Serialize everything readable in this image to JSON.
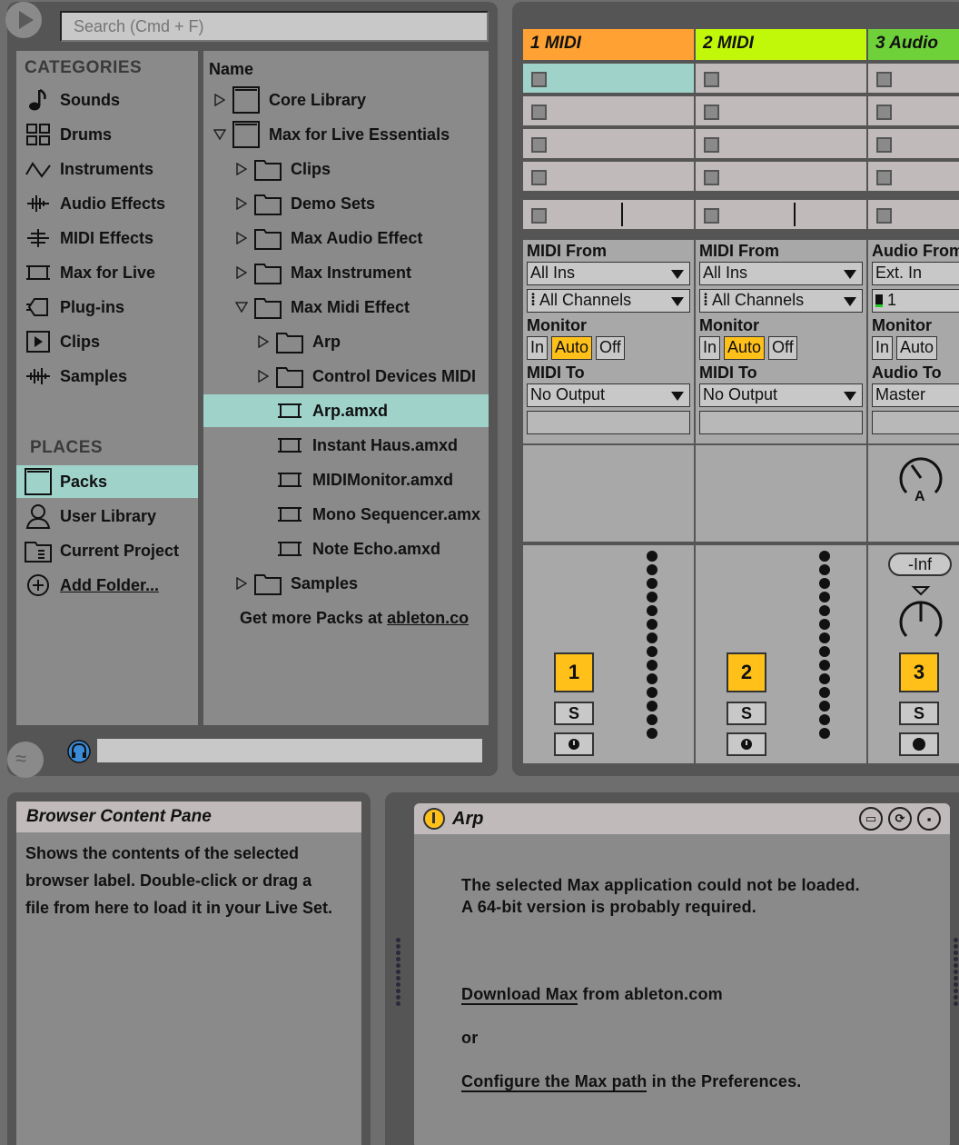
{
  "browser": {
    "search_placeholder": "Search (Cmd + F)",
    "categories_heading": "CATEGORIES",
    "categories": [
      {
        "label": "Sounds",
        "icon": "note-icon"
      },
      {
        "label": "Drums",
        "icon": "grid-icon"
      },
      {
        "label": "Instruments",
        "icon": "waveform-icon"
      },
      {
        "label": "Audio Effects",
        "icon": "audio-effect-icon"
      },
      {
        "label": "MIDI Effects",
        "icon": "midi-effect-icon"
      },
      {
        "label": "Max for Live",
        "icon": "max-device-icon"
      },
      {
        "label": "Plug-ins",
        "icon": "plugin-icon"
      },
      {
        "label": "Clips",
        "icon": "clip-icon"
      },
      {
        "label": "Samples",
        "icon": "sample-wave-icon"
      }
    ],
    "places_heading": "PLACES",
    "places": [
      {
        "label": "Packs",
        "icon": "pack-icon",
        "selected": true
      },
      {
        "label": "User Library",
        "icon": "user-icon"
      },
      {
        "label": "Current Project",
        "icon": "project-icon"
      },
      {
        "label": "Add Folder...",
        "icon": "add-folder-icon"
      }
    ],
    "column_header": "Name",
    "tree": [
      {
        "label": "Core Library",
        "depth": 0,
        "type": "pack",
        "expand": "collapsed"
      },
      {
        "label": "Max for Live Essentials",
        "depth": 0,
        "type": "pack",
        "expand": "expanded"
      },
      {
        "label": "Clips",
        "depth": 1,
        "type": "folder",
        "expand": "collapsed"
      },
      {
        "label": "Demo Sets",
        "depth": 1,
        "type": "folder",
        "expand": "collapsed"
      },
      {
        "label": "Max Audio Effect",
        "depth": 1,
        "type": "folder",
        "expand": "collapsed"
      },
      {
        "label": "Max Instrument",
        "depth": 1,
        "type": "folder",
        "expand": "collapsed"
      },
      {
        "label": "Max Midi Effect",
        "depth": 1,
        "type": "folder",
        "expand": "expanded"
      },
      {
        "label": "Arp",
        "depth": 2,
        "type": "folder",
        "expand": "collapsed"
      },
      {
        "label": "Control Devices MIDI",
        "depth": 2,
        "type": "folder",
        "expand": "collapsed"
      },
      {
        "label": "Arp.amxd",
        "depth": 2,
        "type": "device",
        "expand": "none",
        "selected": true
      },
      {
        "label": "Instant Haus.amxd",
        "depth": 2,
        "type": "device",
        "expand": "none"
      },
      {
        "label": "MIDIMonitor.amxd",
        "depth": 2,
        "type": "device",
        "expand": "none"
      },
      {
        "label": "Mono Sequencer.amx",
        "depth": 2,
        "type": "device",
        "expand": "none"
      },
      {
        "label": "Note Echo.amxd",
        "depth": 2,
        "type": "device",
        "expand": "none"
      },
      {
        "label": "Samples",
        "depth": 1,
        "type": "folder",
        "expand": "collapsed"
      }
    ],
    "more_packs_text": "Get more Packs at",
    "more_packs_link": "ableton.co"
  },
  "tracks": [
    {
      "name": "1 MIDI",
      "color": "#ffa233",
      "io_from_label": "MIDI From",
      "io_from": "All Ins",
      "channel": "All Channels",
      "monitor_label": "Monitor",
      "monitor": [
        "In",
        "Auto",
        "Off"
      ],
      "io_to_label": "MIDI To",
      "io_to": "No Output",
      "number": "1",
      "solo": "S"
    },
    {
      "name": "2 MIDI",
      "color": "#c1f80a",
      "io_from_label": "MIDI From",
      "io_from": "All Ins",
      "channel": "All Channels",
      "monitor_label": "Monitor",
      "monitor": [
        "In",
        "Auto",
        "Off"
      ],
      "io_to_label": "MIDI To",
      "io_to": "No Output",
      "number": "2",
      "solo": "S"
    },
    {
      "name": "3 Audio",
      "color": "#6fd13a",
      "io_from_label": "Audio From",
      "io_from": "Ext. In",
      "channel": "1",
      "monitor_label": "Monitor",
      "monitor": [
        "In",
        "Auto"
      ],
      "io_to_label": "Audio To",
      "io_to": "Master",
      "number": "3",
      "solo": "S",
      "volume": "-Inf",
      "send_label": "A"
    }
  ],
  "info": {
    "title": "Browser Content Pane",
    "lines": [
      "Shows the contents of the selected",
      "browser label. Double-click or drag a",
      "file from here to load it in your Live Set."
    ]
  },
  "device": {
    "title": "Arp",
    "message_line1": "The selected Max application could not be loaded.",
    "message_line2": "A 64-bit version is probably required.",
    "download_link": "Download Max",
    "download_rest": "from ableton.com",
    "or": "or",
    "configure_link": "Configure the Max path",
    "configure_rest": "in the Preferences."
  },
  "colors": {
    "accent_selection": "#9fd3ca",
    "button_on": "#ffc01a"
  }
}
